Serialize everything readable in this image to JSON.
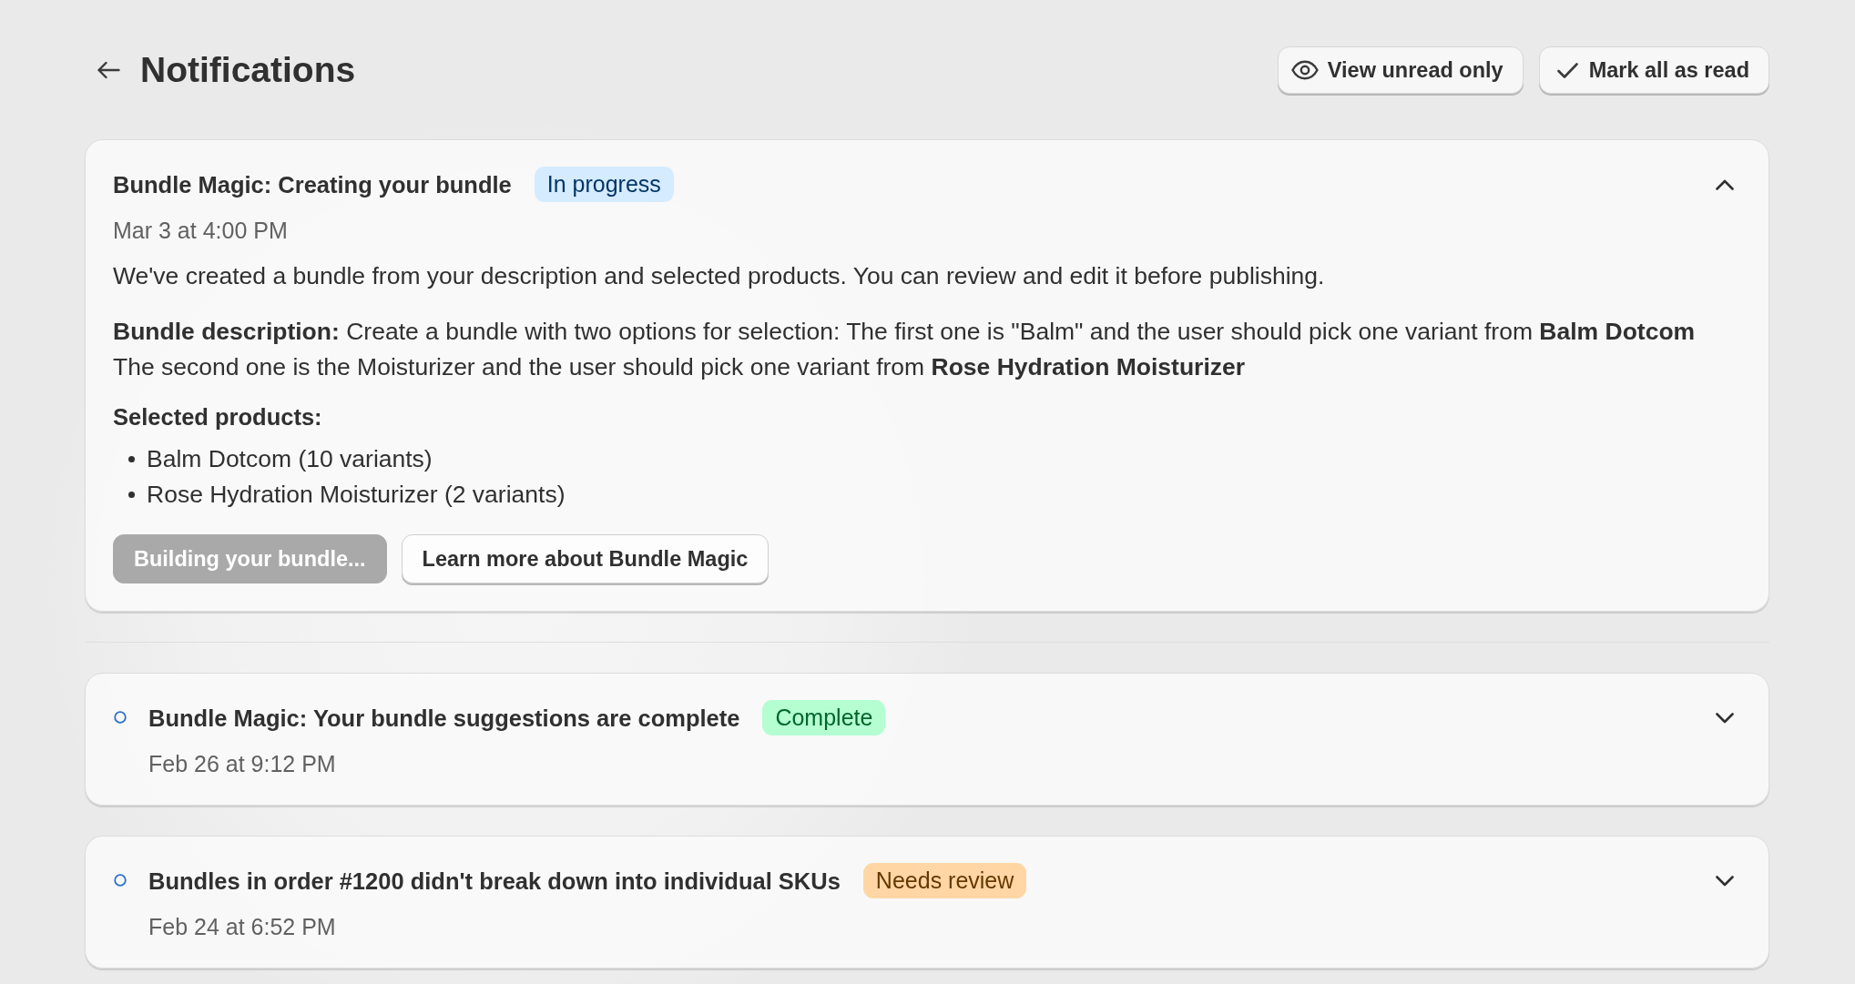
{
  "header": {
    "title": "Notifications",
    "view_unread_button": {
      "label": "View unread only"
    },
    "mark_all_read_button": {
      "label": "Mark all as read"
    }
  },
  "notifications": [
    {
      "title": "Bundle Magic: Creating your bundle",
      "badge": {
        "label": "In progress",
        "color": "#d5ebff"
      },
      "time": "Mar 3 at 4:00 PM",
      "unread": false,
      "expanded": true,
      "message": "We've created a bundle from your description and selected products. You can review and edit it before publishing.",
      "description": "**Bundle description:** Create a bundle with two options for selection: The first one is \"Balm\" and the user should pick one variant from **Balm Dotcom** The second one is the Moisturizer and the user should pick one variant from **Rose Hydration Moisturizer**",
      "products_heading": "Selected products:",
      "products": [
        "Balm Dotcom (10 variants)",
        "Rose Hydration Moisturizer (2 variants)"
      ],
      "actions": [
        {
          "label": "Building your bundle...",
          "disabled": true
        },
        {
          "label": "Learn more about Bundle Magic",
          "disabled": false
        }
      ]
    },
    {
      "title": "Bundle Magic: Your bundle suggestions are complete",
      "badge": {
        "label": "Complete",
        "color": "#b4fed2"
      },
      "time": "Feb 26 at 9:12 PM",
      "unread": true,
      "expanded": false
    },
    {
      "title": "Bundles in order #1200 didn't break down into individual SKUs",
      "badge": {
        "label": "Needs review",
        "color": "#ffd6a4"
      },
      "time": "Feb 24 at 6:52 PM",
      "unread": true,
      "expanded": false
    }
  ]
}
